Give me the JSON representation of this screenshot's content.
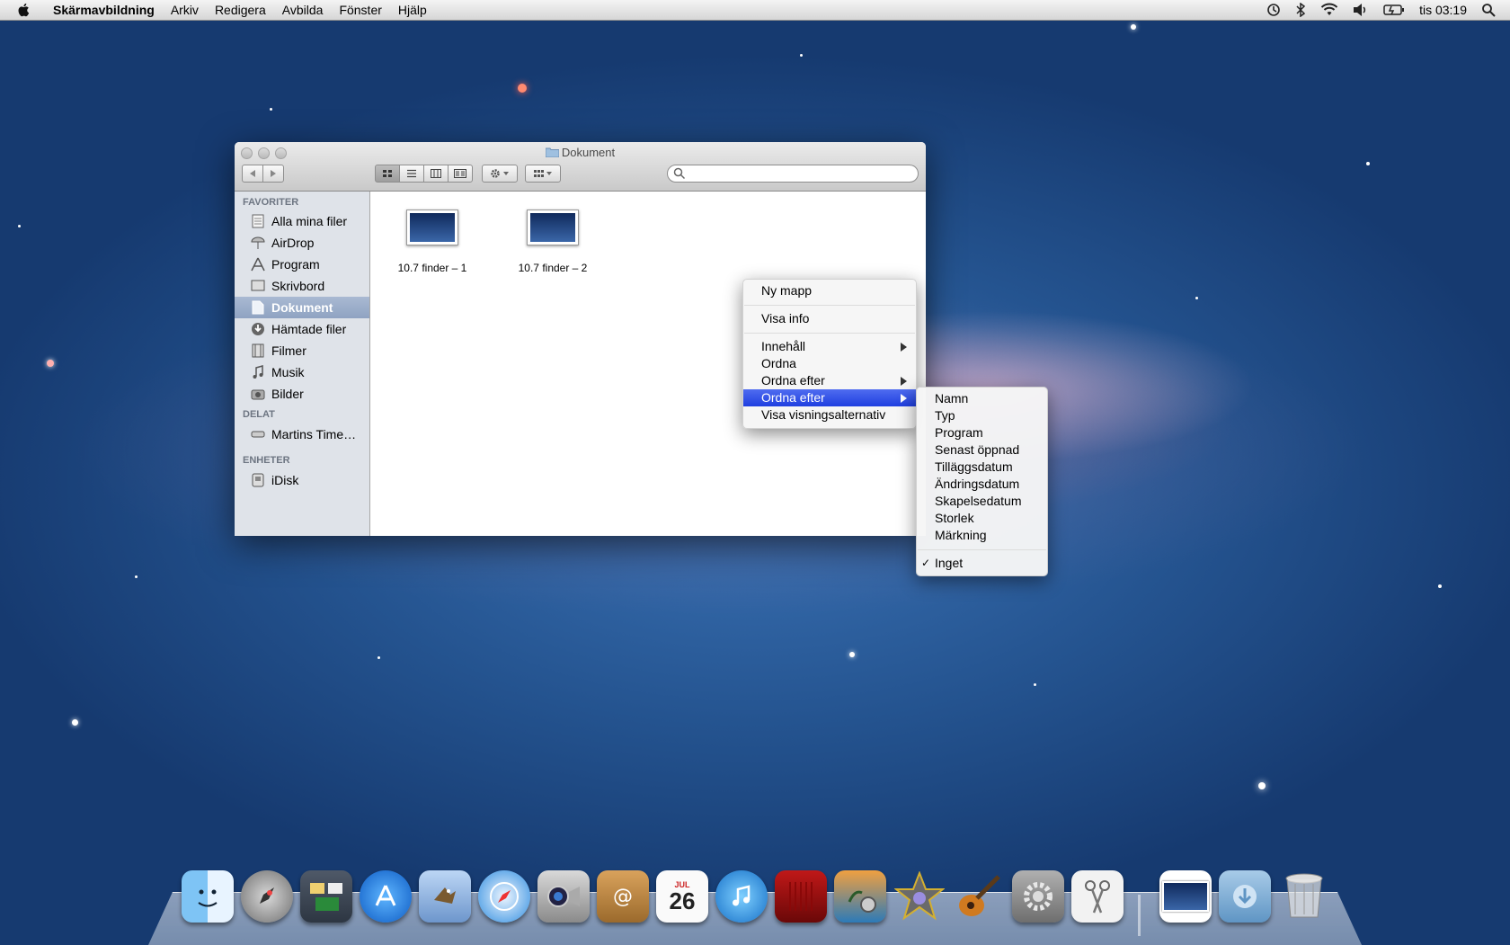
{
  "menubar": {
    "app_name": "Skärmavbildning",
    "items": [
      "Arkiv",
      "Redigera",
      "Avbilda",
      "Fönster",
      "Hjälp"
    ],
    "clock": "tis 03:19"
  },
  "finder": {
    "title": "Dokument",
    "sidebar": {
      "favorites_header": "FAVORITER",
      "favorites": [
        "Alla mina filer",
        "AirDrop",
        "Program",
        "Skrivbord",
        "Dokument",
        "Hämtade filer",
        "Filmer",
        "Musik",
        "Bilder"
      ],
      "shared_header": "DELAT",
      "shared": [
        "Martins Time…"
      ],
      "devices_header": "ENHETER",
      "devices": [
        "iDisk"
      ]
    },
    "files": [
      "10.7 finder – 1",
      "10.7 finder – 2"
    ]
  },
  "context_menu": {
    "items": [
      "Ny mapp",
      "Visa info",
      "Innehåll",
      "Ordna",
      "Ordna efter",
      "Ordna efter",
      "Visa visningsalternativ"
    ]
  },
  "submenu": {
    "items": [
      "Namn",
      "Typ",
      "Program",
      "Senast öppnad",
      "Tilläggsdatum",
      "Ändringsdatum",
      "Skapelsedatum",
      "Storlek",
      "Märkning"
    ],
    "checked_item": "Inget",
    "checkmark": "✓"
  },
  "dock": {
    "apps": [
      "finder-icon",
      "launchpad-icon",
      "mission-control-icon",
      "app-store-icon",
      "mail-icon",
      "safari-icon",
      "facetime-icon",
      "address-book-icon",
      "ical-icon",
      "itunes-icon",
      "photo-booth-icon",
      "iphoto-icon",
      "imovie-icon",
      "garageband-icon",
      "system-preferences-icon",
      "grab-icon",
      "screenshot-stack-icon",
      "downloads-stack-icon",
      "trash-icon"
    ],
    "ical_month": "JUL",
    "ical_day": "26"
  },
  "colors": {
    "menu_highlight": "#2443e4",
    "sidebar_bg": "#dfe3e9",
    "desktop_blue": "#24538f"
  }
}
